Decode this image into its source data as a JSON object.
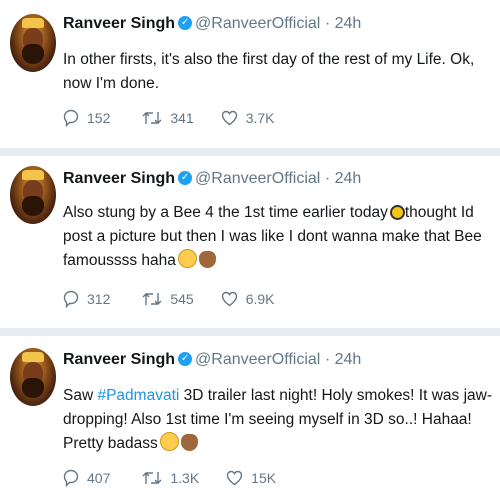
{
  "tweets": [
    {
      "name": "Ranveer Singh",
      "handle": "@RanveerOfficial",
      "sep": "·",
      "time": "24h",
      "text_parts": [
        "In other firsts, it's also the first day of the rest of my Life. Ok, now I'm done."
      ],
      "replies": "152",
      "retweets": "341",
      "likes": "3.7K"
    },
    {
      "name": "Ranveer Singh",
      "handle": "@RanveerOfficial",
      "sep": "·",
      "time": "24h",
      "text_parts": [
        "Also stung by a Bee 4 the 1st time earlier today",
        "thought Id post a picture but then I was like I dont wanna make that Bee famoussss  haha"
      ],
      "replies": "312",
      "retweets": "545",
      "likes": "6.9K"
    },
    {
      "name": "Ranveer Singh",
      "handle": "@RanveerOfficial",
      "sep": "·",
      "time": "24h",
      "text_parts": [
        "Saw ",
        "#Padmavati",
        " 3D trailer last night! Holy smokes! It was jaw-dropping! Also 1st time I'm seeing myself in 3D so..! Hahaa! Pretty badass"
      ],
      "replies": "407",
      "retweets": "1.3K",
      "likes": "15K"
    }
  ],
  "icons": {
    "reply": "reply-icon",
    "retweet": "retweet-icon",
    "like": "heart-icon",
    "verified": "verified-badge-icon",
    "emoji_bee": "bee-emoji-icon",
    "emoji_laugh": "laughing-tears-emoji-icon",
    "emoji_hand": "clapping-hand-emoji-icon"
  },
  "colors": {
    "accent": "#1da1f2",
    "hashtag": "#1b95e0",
    "muted": "#657786",
    "divider": "#e6ecf0"
  }
}
